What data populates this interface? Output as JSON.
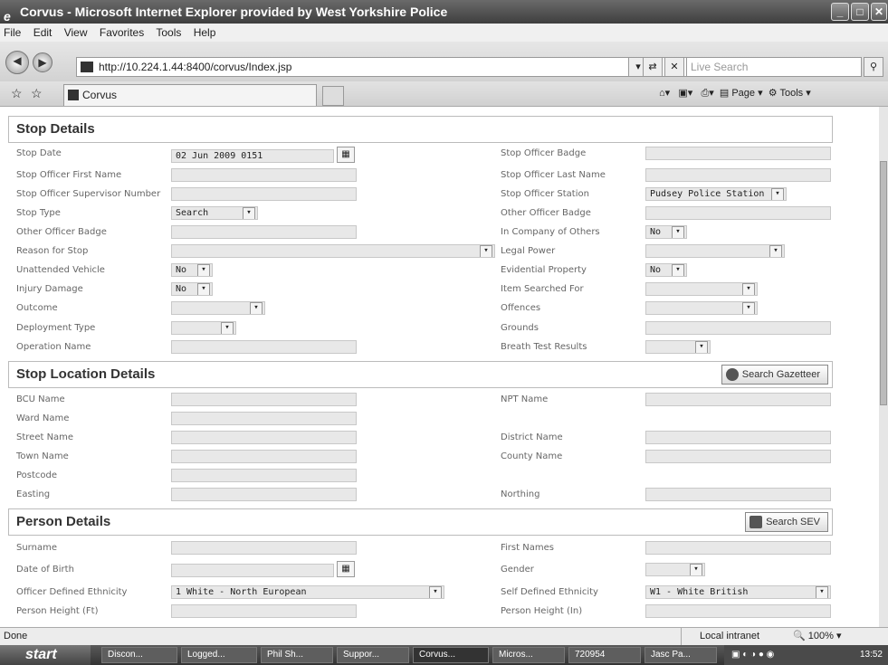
{
  "window": {
    "title": "Corvus - Microsoft Internet Explorer provided by West Yorkshire Police",
    "ie_icon": "e"
  },
  "menu": [
    "File",
    "Edit",
    "View",
    "Favorites",
    "Tools",
    "Help"
  ],
  "address": {
    "url": "http://10.224.1.44:8400/corvus/Index.jsp",
    "search_placeholder": "Live Search"
  },
  "tab": {
    "label": "Corvus"
  },
  "toolbar": {
    "page_label": "Page",
    "tools_label": "Tools"
  },
  "sections": {
    "stop": {
      "title": "Stop Details"
    },
    "location": {
      "title": "Stop Location Details",
      "button": "Search Gazetteer"
    },
    "person": {
      "title": "Person Details",
      "button": "Search SEV"
    }
  },
  "stop_fields": [
    {
      "label": "Stop Date",
      "value": "02 Jun 2009 0151"
    },
    {
      "label": "Stop Officer First Name",
      "value": ""
    },
    {
      "label": "Stop Officer Supervisor Number",
      "value": ""
    },
    {
      "label": "Stop Type",
      "value": "Search"
    },
    {
      "label": "Other Officer Badge",
      "value": ""
    },
    {
      "label": "Reason for Stop",
      "value": ""
    },
    {
      "label": "Unattended Vehicle",
      "value": "No"
    },
    {
      "label": "Injury Damage",
      "value": "No"
    },
    {
      "label": "Outcome",
      "value": ""
    },
    {
      "label": "Deployment Type",
      "value": ""
    },
    {
      "label": "Operation Name",
      "value": ""
    },
    {
      "label": "Stop Officer Badge",
      "value": ""
    },
    {
      "label": "Stop Officer Last Name",
      "value": ""
    },
    {
      "label": "Stop Officer Station",
      "value": "Pudsey Police Station"
    },
    {
      "label": "Other Officer Badge",
      "value": ""
    },
    {
      "label": "In Company of Others",
      "value": "No"
    },
    {
      "label": "Legal Power",
      "value": ""
    },
    {
      "label": "Evidential Property",
      "value": "No"
    },
    {
      "label": "Item Searched For",
      "value": ""
    },
    {
      "label": "Offences",
      "value": ""
    },
    {
      "label": "Grounds",
      "value": ""
    },
    {
      "label": "Breath Test Results",
      "value": ""
    }
  ],
  "location_fields": [
    {
      "label": "BCU Name",
      "value": ""
    },
    {
      "label": "Ward Name",
      "value": ""
    },
    {
      "label": "Street Name",
      "value": ""
    },
    {
      "label": "Town Name",
      "value": ""
    },
    {
      "label": "Postcode",
      "value": ""
    },
    {
      "label": "Easting",
      "value": ""
    },
    {
      "label": "NPT Name",
      "value": ""
    },
    {
      "label": "District Name",
      "value": ""
    },
    {
      "label": "County Name",
      "value": ""
    },
    {
      "label": "Northing",
      "value": ""
    }
  ],
  "person_fields": [
    {
      "label": "Surname",
      "value": ""
    },
    {
      "label": "Date of Birth",
      "value": ""
    },
    {
      "label": "Officer Defined Ethnicity",
      "value": "1 White - North European"
    },
    {
      "label": "Person Height (Ft)",
      "value": ""
    },
    {
      "label": "First Names",
      "value": ""
    },
    {
      "label": "Gender",
      "value": ""
    },
    {
      "label": "Self Defined Ethnicity",
      "value": "W1 - White British"
    },
    {
      "label": "Person Height (In)",
      "value": ""
    }
  ],
  "statusbar": {
    "left": "Done",
    "zone": "Local intranet",
    "zoom": "100%"
  },
  "taskbar": {
    "start": "start",
    "items": [
      "Discon...",
      "Logged...",
      "Phil Sh...",
      "Suppor...",
      "Corvus...",
      "Micros...",
      "720954",
      "Jasc Pa..."
    ],
    "clock": "13:52"
  }
}
